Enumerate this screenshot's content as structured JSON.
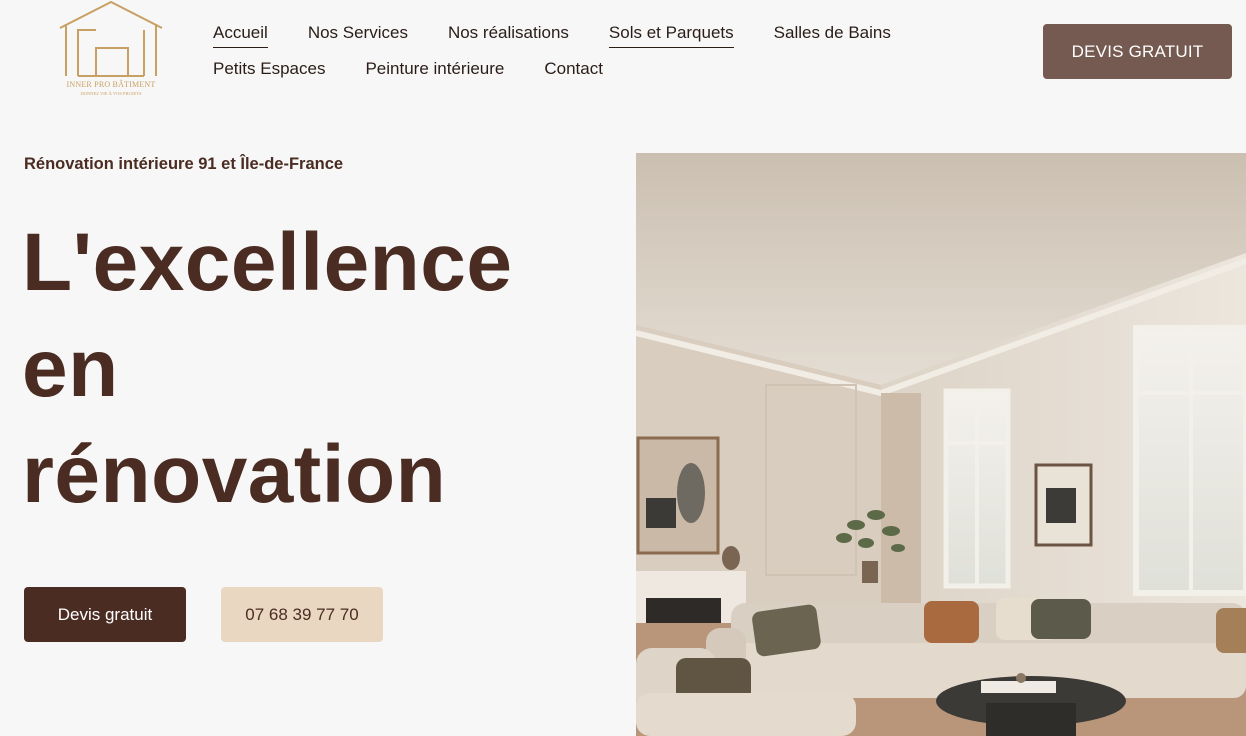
{
  "logo": {
    "name": "INNER PRO BÂTIMENT",
    "tagline": "DONNEZ VIE À VOS PROJETS",
    "color": "#c9a063"
  },
  "nav": {
    "row1": [
      {
        "label": "Accueil",
        "underlined": true
      },
      {
        "label": "Nos Services",
        "underlined": false
      },
      {
        "label": "Nos réalisations",
        "underlined": false
      },
      {
        "label": "Sols et Parquets",
        "underlined": true
      },
      {
        "label": "Salles de Bains",
        "underlined": false
      }
    ],
    "row2": [
      {
        "label": "Petits Espaces",
        "underlined": false
      },
      {
        "label": "Peinture intérieure",
        "underlined": false
      },
      {
        "label": "Contact",
        "underlined": false
      }
    ]
  },
  "header": {
    "cta_label": "DEVIS GRATUIT"
  },
  "hero": {
    "kicker": "Rénovation intérieure 91 et Île-de-France",
    "title_lines": [
      "L'excellence",
      "en",
      "rénovation"
    ],
    "primary_button": "Devis gratuit",
    "phone_button": "07 68 39 77 70",
    "image_icon": "living-room-photo"
  },
  "colors": {
    "brand_dark": "#4a2c22",
    "header_cta": "#745a50",
    "phone_bg": "#ead7c2",
    "page_bg": "#f7f7f7"
  }
}
